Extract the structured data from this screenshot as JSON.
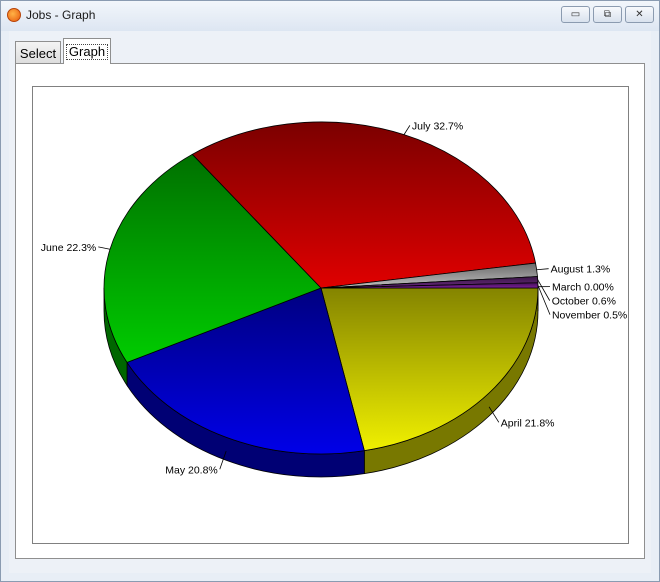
{
  "window": {
    "title": "Jobs - Graph"
  },
  "window_buttons": {
    "minimize": "▭",
    "restore": "⧉",
    "close": "✕"
  },
  "tabs": [
    {
      "label": "Select",
      "active": false
    },
    {
      "label": "Graph",
      "active": true
    }
  ],
  "chart_data": {
    "type": "pie",
    "style": "3d",
    "slices": [
      {
        "label": "March",
        "value": 0.0,
        "display": "March 0.00%",
        "color": "#9b1fb0"
      },
      {
        "label": "April",
        "value": 21.8,
        "display": "April 21.8%",
        "color": "#f0f000"
      },
      {
        "label": "May",
        "value": 20.8,
        "display": "May 20.8%",
        "color": "#0000e8"
      },
      {
        "label": "June",
        "value": 22.3,
        "display": "June 22.3%",
        "color": "#00cc00"
      },
      {
        "label": "July",
        "value": 32.7,
        "display": "July 32.7%",
        "color": "#e00000"
      },
      {
        "label": "August",
        "value": 1.3,
        "display": "August 1.3%",
        "color": "#c0c0c0"
      },
      {
        "label": "October",
        "value": 0.6,
        "display": "October 0.6%",
        "color": "#6a2a80"
      },
      {
        "label": "November",
        "value": 0.5,
        "display": "November 0.5%",
        "color": "#7a1f9a"
      }
    ]
  }
}
